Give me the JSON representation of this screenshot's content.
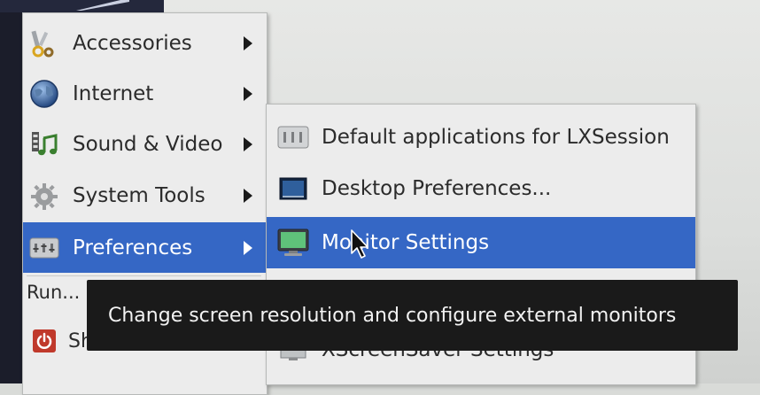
{
  "main_menu": {
    "items": [
      {
        "label": "Accessories",
        "icon": "accessories-icon"
      },
      {
        "label": "Internet",
        "icon": "internet-globe-icon"
      },
      {
        "label": "Sound & Video",
        "icon": "sound-video-icon"
      },
      {
        "label": "System Tools",
        "icon": "system-tools-gear-icon"
      },
      {
        "label": "Preferences",
        "icon": "preferences-icon"
      }
    ],
    "run_label": "Run...",
    "shutdown_label": "Shutdown..."
  },
  "sub_menu": {
    "items": [
      {
        "label": "Default applications for LXSession",
        "icon": "default-apps-icon"
      },
      {
        "label": "Desktop Preferences...",
        "icon": "desktop-preferences-icon"
      },
      {
        "label": "Monitor Settings",
        "icon": "monitor-icon"
      },
      {
        "label": "XScreenSaver Settings",
        "icon": "screensaver-icon"
      }
    ]
  },
  "tooltip": {
    "text": "Change screen resolution and configure external monitors"
  },
  "colors": {
    "highlight": "#3567c5",
    "menu_bg": "#ececec",
    "tooltip_bg": "#1a1a1a",
    "shutdown_red": "#c0392b"
  }
}
